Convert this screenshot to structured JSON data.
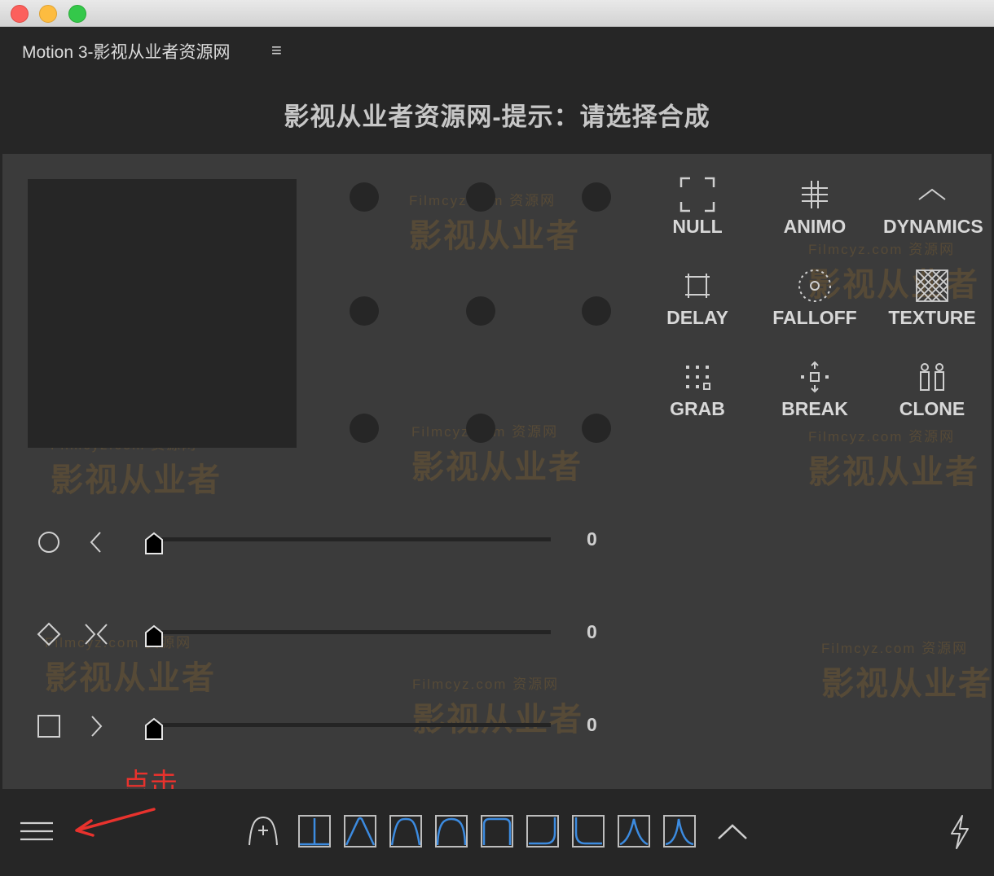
{
  "panel": {
    "title": "Motion 3-影视从业者资源网",
    "menu_glyph": "≡",
    "prompt": "影视从业者资源网-提示：请选择合成"
  },
  "tools": [
    {
      "id": "null",
      "label": "NULL",
      "icon": "null-icon"
    },
    {
      "id": "animo",
      "label": "ANIMO",
      "icon": "animo-icon"
    },
    {
      "id": "dynamics",
      "label": "DYNAMICS",
      "icon": "dynamics-icon"
    },
    {
      "id": "delay",
      "label": "DELAY",
      "icon": "delay-icon"
    },
    {
      "id": "falloff",
      "label": "FALLOFF",
      "icon": "falloff-icon"
    },
    {
      "id": "texture",
      "label": "TEXTURE",
      "icon": "texture-icon"
    },
    {
      "id": "grab",
      "label": "GRAB",
      "icon": "grab-icon"
    },
    {
      "id": "break",
      "label": "BREAK",
      "icon": "break-icon"
    },
    {
      "id": "clone",
      "label": "CLONE",
      "icon": "clone-icon"
    }
  ],
  "sliders": [
    {
      "shape_icon": "circle-icon",
      "direction_icon": "chevron-left-icon",
      "value": "0"
    },
    {
      "shape_icon": "diamond-icon",
      "direction_icon": "expand-x-icon",
      "value": "0"
    },
    {
      "shape_icon": "square-icon",
      "direction_icon": "chevron-right-icon",
      "value": "0"
    }
  ],
  "annotation": {
    "text": "点击",
    "color": "#e8322d"
  },
  "easing_presets": [
    "linear-curve",
    "ease-in-out-curve",
    "ease-curve",
    "ease-out-back-curve",
    "flat-top-curve",
    "ease-in-curve",
    "ease-out-curve",
    "sharp-in-out-curve",
    "spike-curve"
  ],
  "watermark": {
    "text": "影视从业者",
    "site": "Filmcyz.com",
    "tag": "资源网"
  },
  "colors": {
    "accent_blue": "#3c8be0",
    "panel_bg": "#262626",
    "main_bg": "#3b3b3b"
  }
}
